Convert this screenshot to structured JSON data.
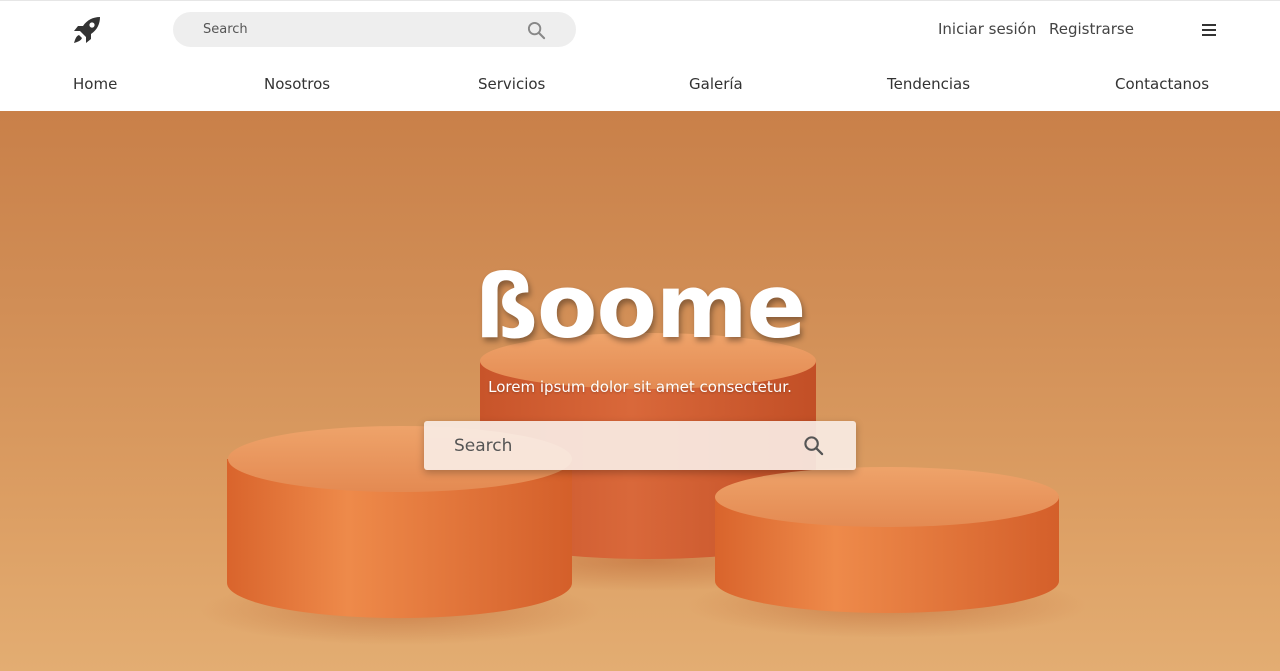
{
  "header": {
    "logo_icon": "rocket-icon",
    "search": {
      "placeholder": "Search",
      "value": "",
      "icon": "search-icon"
    },
    "login_label": "Iniciar sesión",
    "register_label": "Registrarse",
    "menu_icon": "hamburger-menu-icon"
  },
  "nav": {
    "items": [
      {
        "label": "Home"
      },
      {
        "label": "Nosotros"
      },
      {
        "label": "Servicios"
      },
      {
        "label": "Galería"
      },
      {
        "label": "Tendencias"
      },
      {
        "label": "Contactanos"
      }
    ]
  },
  "hero": {
    "title": "ßoome",
    "tagline": "Lorem ipsum dolor sit amet consectetur.",
    "search": {
      "placeholder": "Search",
      "value": "",
      "icon": "search-icon"
    },
    "background_color": "#d18e56",
    "podium_color": "#e07a3d"
  }
}
